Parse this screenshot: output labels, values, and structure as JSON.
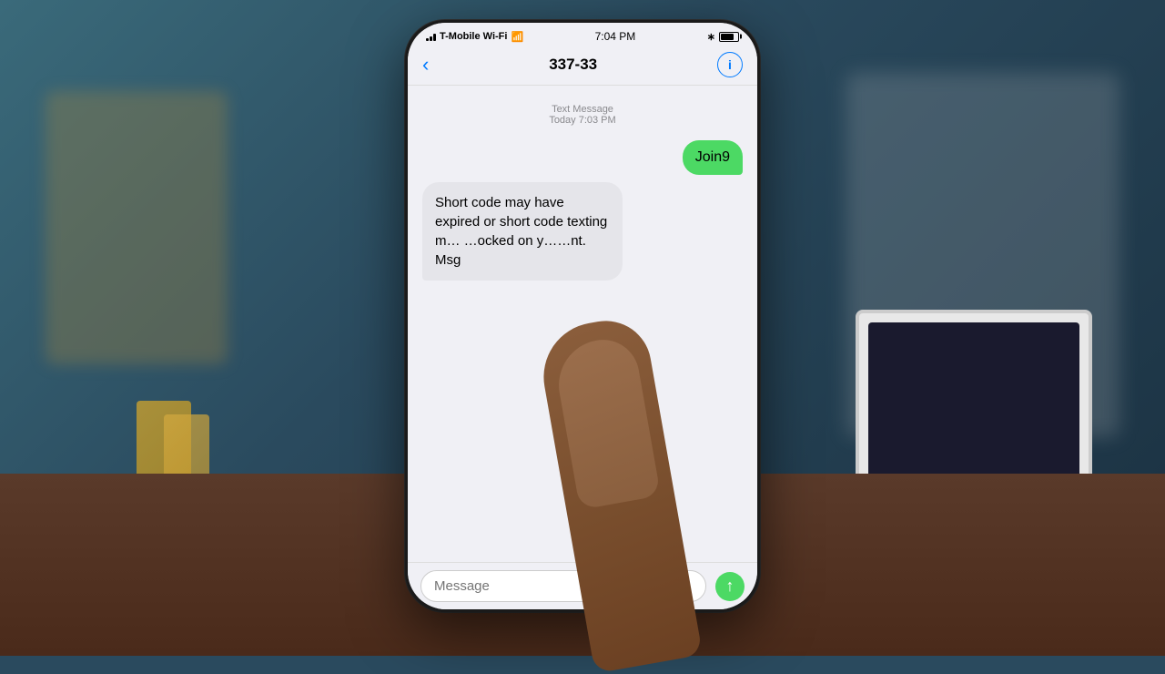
{
  "scene": {
    "background_color": "#2a4a5e"
  },
  "phone": {
    "status_bar": {
      "signal": "▌▌",
      "carrier": "T-Mobile Wi-Fi",
      "wifi_icon": "wifi",
      "time": "7:04 PM",
      "bluetooth_icon": "bluetooth",
      "battery_icon": "battery"
    },
    "nav": {
      "back_icon": "‹",
      "title": "337-33",
      "info_icon": "ⓘ"
    },
    "messages": {
      "timestamp_label": "Text Message",
      "timestamp_time": "Today 7:03 PM",
      "sent_bubble": "Join9",
      "received_bubble": "Short code may have expired or short code texting m… …ocked on y……nt. Msg"
    },
    "input": {
      "placeholder": "Message",
      "send_icon": "up-arrow"
    }
  }
}
